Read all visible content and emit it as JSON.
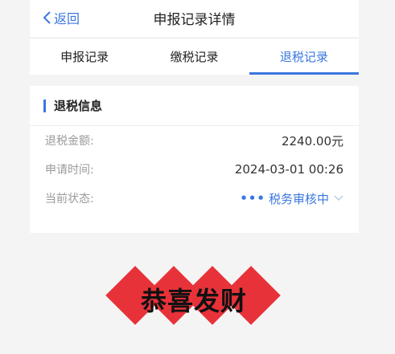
{
  "header": {
    "back_label": "返回",
    "title": "申报记录详情"
  },
  "tabs": [
    {
      "label": "申报记录",
      "active": false
    },
    {
      "label": "缴税记录",
      "active": false
    },
    {
      "label": "退税记录",
      "active": true
    }
  ],
  "refund_info": {
    "section_title": "退税信息",
    "rows": [
      {
        "label": "退税金额:",
        "value": "2240.00元"
      },
      {
        "label": "申请时间:",
        "value": "2024-03-01 00:26"
      },
      {
        "label": "当前状态:",
        "value": "税务审核中"
      }
    ],
    "status_dots": "•••"
  },
  "banner": {
    "text": "恭喜发财"
  },
  "colors": {
    "accent": "#3a77e0",
    "banner_red": "#e8323a"
  },
  "icons": {
    "back": "chevron-left-icon",
    "status_expand": "chevron-down-icon"
  }
}
